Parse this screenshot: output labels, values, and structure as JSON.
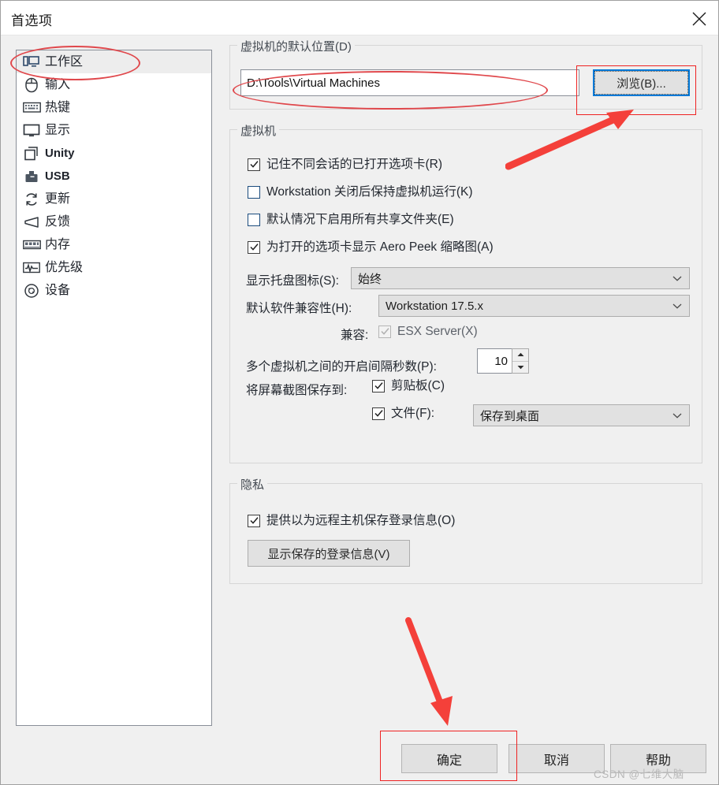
{
  "window": {
    "title": "首选项",
    "close_icon": "close-icon"
  },
  "sidebar": {
    "items": [
      {
        "label": "工作区",
        "icon": "workspace-icon",
        "selected": true,
        "latin": false
      },
      {
        "label": "输入",
        "icon": "mouse-icon",
        "selected": false,
        "latin": false
      },
      {
        "label": "热键",
        "icon": "keyboard-icon",
        "selected": false,
        "latin": false
      },
      {
        "label": "显示",
        "icon": "display-icon",
        "selected": false,
        "latin": false
      },
      {
        "label": "Unity",
        "icon": "unity-icon",
        "selected": false,
        "latin": true
      },
      {
        "label": "USB",
        "icon": "usb-icon",
        "selected": false,
        "latin": true
      },
      {
        "label": "更新",
        "icon": "refresh-icon",
        "selected": false,
        "latin": false
      },
      {
        "label": "反馈",
        "icon": "megaphone-icon",
        "selected": false,
        "latin": false
      },
      {
        "label": "内存",
        "icon": "memory-icon",
        "selected": false,
        "latin": false
      },
      {
        "label": "优先级",
        "icon": "priority-icon",
        "selected": false,
        "latin": false
      },
      {
        "label": "设备",
        "icon": "device-icon",
        "selected": false,
        "latin": false
      }
    ]
  },
  "default_location": {
    "group_title": "虚拟机的默认位置(D)",
    "path_value": "D:\\Tools\\Virtual Machines",
    "browse_label": "浏览(B)..."
  },
  "virtual_machine": {
    "group_title": "虚拟机",
    "checkboxes": [
      {
        "label": "记住不同会话的已打开选项卡(R)",
        "checked": true,
        "accel": "R",
        "prefix": "",
        "suffix": ""
      },
      {
        "label": "Workstation 关闭后保持虚拟机运行(K)",
        "checked": false,
        "accel": "K"
      },
      {
        "label": "默认情况下启用所有共享文件夹(E)",
        "checked": false,
        "accel": "E"
      },
      {
        "label": "为打开的选项卡显示 Aero Peek 缩略图(A)",
        "checked": true,
        "accel": "A"
      }
    ],
    "tray_label": "显示托盘图标(S):",
    "tray_value": "始终",
    "compat_label": "默认软件兼容性(H):",
    "compat_value": "Workstation 17.5.x",
    "esx_label": "兼容:",
    "esx_checkbox_label": "ESX Server(X)",
    "esx_checked": true,
    "esx_disabled": true,
    "interval_label": "多个虚拟机之间的开启间隔秒数(P):",
    "interval_value": "10",
    "screenshot_label": "将屏幕截图保存到:",
    "clipboard_label": "剪贴板(C)",
    "clipboard_checked": true,
    "file_label": "文件(F):",
    "file_checked": true,
    "file_dest_value": "保存到桌面"
  },
  "privacy": {
    "group_title": "隐私",
    "checkbox_label": "提供以为远程主机保存登录信息(O)",
    "checkbox_checked": true,
    "button_label": "显示保存的登录信息(V)"
  },
  "footer": {
    "ok_label": "确定",
    "cancel_label": "取消",
    "help_label": "帮助"
  },
  "watermark": {
    "text": "CSDN @七维大脑"
  },
  "annotation_colors": {
    "ellipse": "#e0484c",
    "rectangle": "#ef2222",
    "arrow": "#f4403a"
  }
}
